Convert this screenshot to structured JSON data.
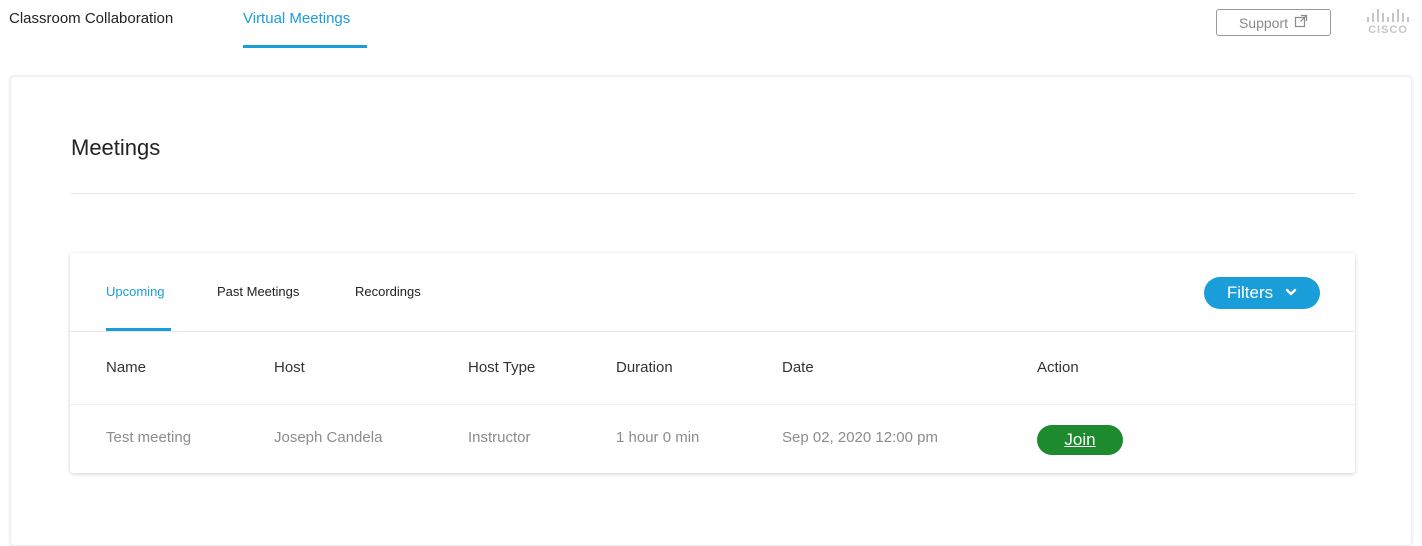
{
  "topnav": {
    "items": [
      {
        "label": "Classroom Collaboration",
        "active": false
      },
      {
        "label": "Virtual Meetings",
        "active": true
      }
    ],
    "support_label": "Support",
    "support_icon": "external-link-icon",
    "logo_text": "CISCO"
  },
  "page": {
    "title": "Meetings"
  },
  "meetings": {
    "tabs": [
      {
        "label": "Upcoming",
        "active": true
      },
      {
        "label": "Past Meetings",
        "active": false
      },
      {
        "label": "Recordings",
        "active": false
      }
    ],
    "filters_label": "Filters",
    "filters_icon": "chevron-down-icon",
    "columns": [
      "Name",
      "Host",
      "Host Type",
      "Duration",
      "Date",
      "Action"
    ],
    "rows": [
      {
        "name": "Test meeting",
        "host": "Joseph Candela",
        "host_type": "Instructor",
        "duration": "1 hour 0 min",
        "date": "Sep 02, 2020 12:00 pm",
        "action_label": "Join"
      }
    ]
  },
  "colors": {
    "accent": "#1a9ed9",
    "join_green": "#1e8a2e",
    "muted_text": "#8c8c8c"
  }
}
